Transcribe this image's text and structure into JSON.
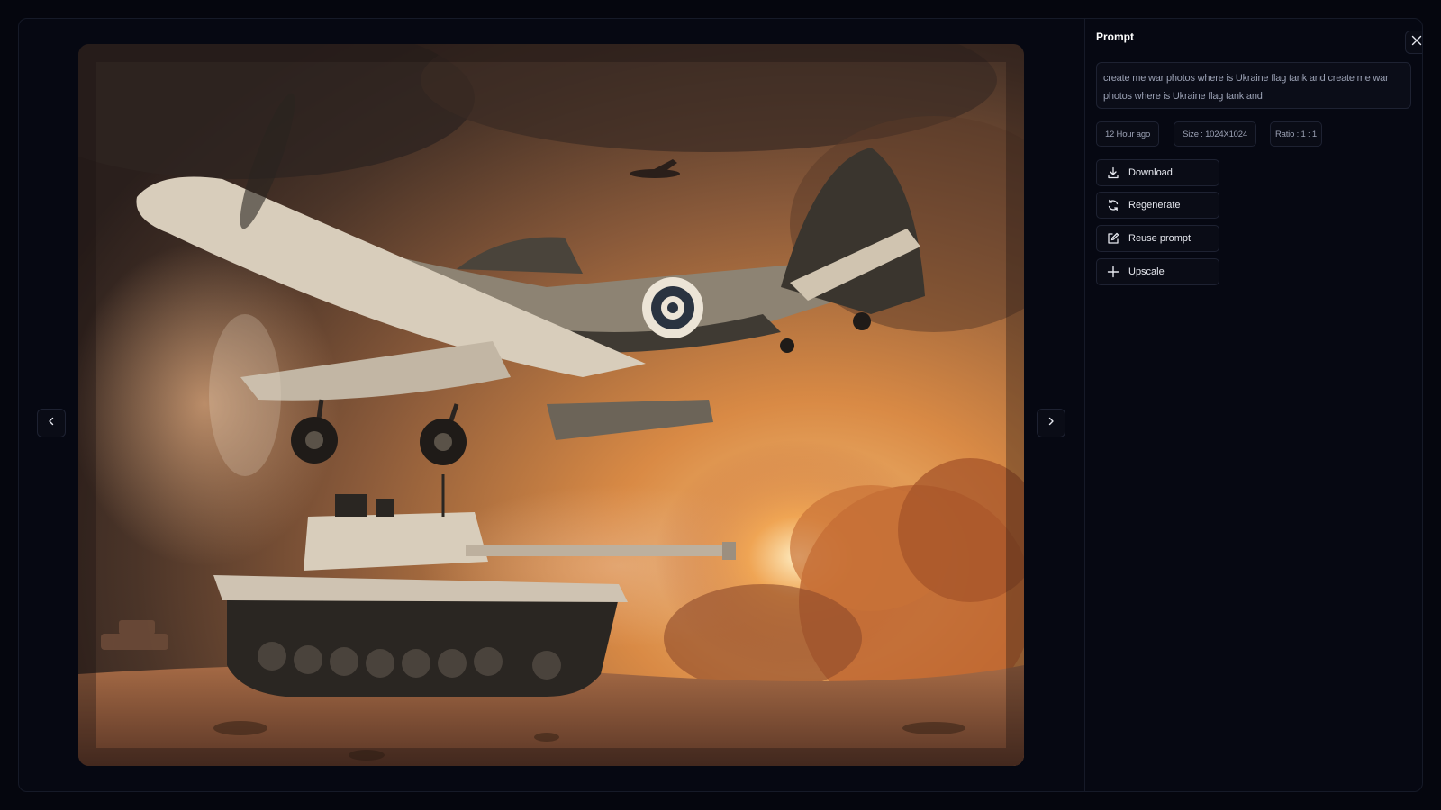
{
  "panel": {
    "title": "Prompt",
    "prompt_text": "create me war photos where is Ukraine flag tank and create me war photos where is Ukraine flag tank and"
  },
  "meta": {
    "time": "12 Hour ago",
    "size": "Size : 1024X1024",
    "ratio": "Ratio : 1 : 1"
  },
  "actions": {
    "download": "Download",
    "regenerate": "Regenerate",
    "reuse_prompt": "Reuse prompt",
    "upscale": "Upscale"
  },
  "image": {
    "subject": "generated image of a propeller warplane flying low over a tank in a dusty battlefield with explosion smoke"
  },
  "icons": {
    "prev": "chevron-left-icon",
    "next": "chevron-right-icon",
    "close": "close-icon",
    "download": "download-icon",
    "regenerate": "refresh-icon",
    "reuse": "edit-icon",
    "upscale": "plus-icon"
  }
}
